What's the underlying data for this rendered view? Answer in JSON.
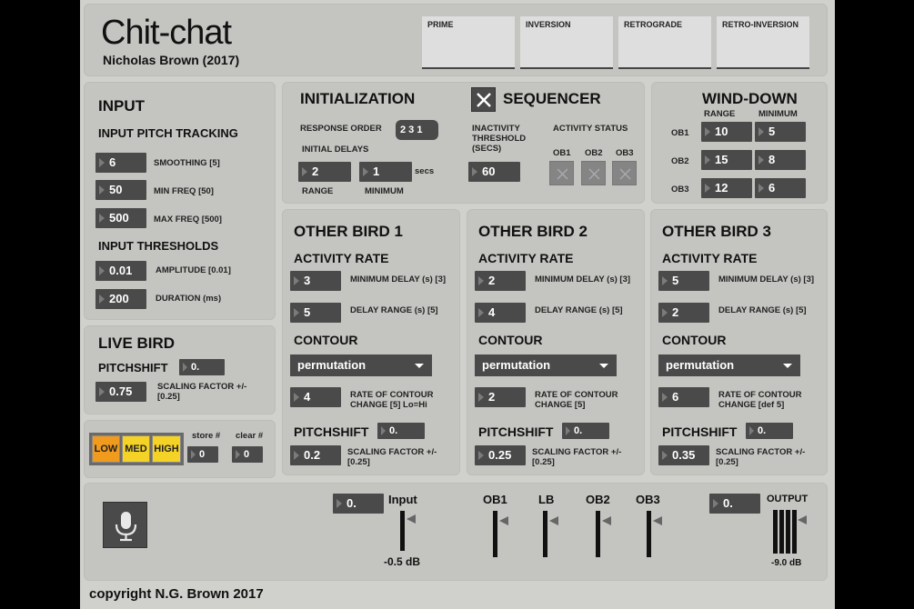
{
  "app": {
    "title": "Chit-chat",
    "author": "Nicholas Brown (2017)",
    "copyright": "copyright N.G. Brown 2017"
  },
  "matrices": [
    "PRIME",
    "INVERSION",
    "RETROGRADE",
    "RETRO-INVERSION"
  ],
  "input": {
    "title": "INPUT",
    "pitch_tracking": "INPUT PITCH TRACKING",
    "smoothing": {
      "value": "6",
      "label": "SMOOTHING [5]"
    },
    "min_freq": {
      "value": "50",
      "label": "MIN FREQ [50]"
    },
    "max_freq": {
      "value": "500",
      "label": "MAX FREQ [500]"
    },
    "thresholds": "INPUT THRESHOLDS",
    "amplitude": {
      "value": "0.01",
      "label": "AMPLITUDE  [0.01]"
    },
    "duration": {
      "value": "200",
      "label": "DURATION (ms)"
    }
  },
  "live_bird": {
    "title": "LIVE BIRD",
    "pitchshift_label": "PITCHSHIFT",
    "pitchshift_value": "0.",
    "scaling_value": "0.75",
    "scaling_label_1": "SCALING FACTOR +/-",
    "scaling_label_2": "[0.25]"
  },
  "presets": {
    "low": "LOW",
    "med": "MED",
    "high": "HIGH",
    "store_label": "store #",
    "store_value": "0",
    "clear_label": "clear #",
    "clear_value": "0",
    "low_color": "#f09a1e",
    "med_color": "#f5d226",
    "high_color": "#f5d226"
  },
  "init": {
    "title": "INITIALIZATION",
    "response_order_label": "RESPONSE ORDER",
    "response_order_value": "2 3 1",
    "initial_delays_label": "INITIAL DELAYS",
    "delay_range_value": "2",
    "delay_min_value": "1",
    "secs_label": "secs",
    "range_label": "RANGE",
    "minimum_label": "MINIMUM"
  },
  "sequencer": {
    "title": "SEQUENCER",
    "inactivity_label_1": "INACTIVITY",
    "inactivity_label_2": "THRESHOLD",
    "inactivity_label_3": "(SECS)",
    "inactivity_value": "60",
    "activity_status_label": "ACTIVITY STATUS",
    "ob1": "OB1",
    "ob2": "OB2",
    "ob3": "OB3"
  },
  "wind_down": {
    "title": "WIND-DOWN",
    "range_label": "RANGE",
    "minimum_label": "MINIMUM",
    "rows": [
      {
        "label": "OB1",
        "range": "10",
        "minimum": "5"
      },
      {
        "label": "OB2",
        "range": "15",
        "minimum": "8"
      },
      {
        "label": "OB3",
        "range": "12",
        "minimum": "6"
      }
    ]
  },
  "birds": [
    {
      "title": "OTHER BIRD 1",
      "activity_rate": "ACTIVITY RATE",
      "min_delay": "3",
      "min_delay_label": "MINIMUM DELAY (s) [3]",
      "delay_range": "5",
      "delay_range_label": "DELAY RANGE (s) [5]",
      "contour": "CONTOUR",
      "contour_mode": "permutation",
      "rate_contour": "4",
      "rate_label_1": "RATE OF CONTOUR",
      "rate_label_2": "CHANGE  [5] Lo=Hi",
      "pitchshift": "PITCHSHIFT",
      "pitchshift_value": "0.",
      "scaling": "0.2",
      "scaling_label_1": "SCALING FACTOR +/-",
      "scaling_label_2": "[0.25]"
    },
    {
      "title": "OTHER BIRD 2",
      "activity_rate": "ACTIVITY RATE",
      "min_delay": "2",
      "min_delay_label": "MINIMUM DELAY (s) [3]",
      "delay_range": "4",
      "delay_range_label": "DELAY RANGE (s) [5]",
      "contour": "CONTOUR",
      "contour_mode": "permutation",
      "rate_contour": "2",
      "rate_label_1": "RATE OF CONTOUR",
      "rate_label_2": "CHANGE  [5]",
      "pitchshift": "PITCHSHIFT",
      "pitchshift_value": "0.",
      "scaling": "0.25",
      "scaling_label_1": "SCALING FACTOR +/-",
      "scaling_label_2": "[0.25]"
    },
    {
      "title": "OTHER BIRD 3",
      "activity_rate": "ACTIVITY RATE",
      "min_delay": "5",
      "min_delay_label": "MINIMUM DELAY (s) [3]",
      "delay_range": "2",
      "delay_range_label": "DELAY RANGE (s) [5]",
      "contour": "CONTOUR",
      "contour_mode": "permutation",
      "rate_contour": "6",
      "rate_label_1": "RATE OF CONTOUR",
      "rate_label_2": "CHANGE  [def 5]",
      "pitchshift": "PITCHSHIFT",
      "pitchshift_value": "0.",
      "scaling": "0.35",
      "scaling_label_1": "SCALING FACTOR +/-",
      "scaling_label_2": "[0.25]"
    }
  ],
  "io": {
    "input_value": "0.",
    "input_label": "Input",
    "input_db": "-0.5 dB",
    "ob1": "OB1",
    "lb": "LB",
    "ob2": "OB2",
    "ob3": "OB3",
    "output_value": "0.",
    "output_label": "OUTPUT",
    "output_db": "-9.0 dB"
  },
  "icons": {
    "mic": "microphone-icon",
    "toggle": "x-toggle-icon",
    "arrow": "number-box-arrow-icon",
    "dropdown": "chevron-down-icon"
  }
}
